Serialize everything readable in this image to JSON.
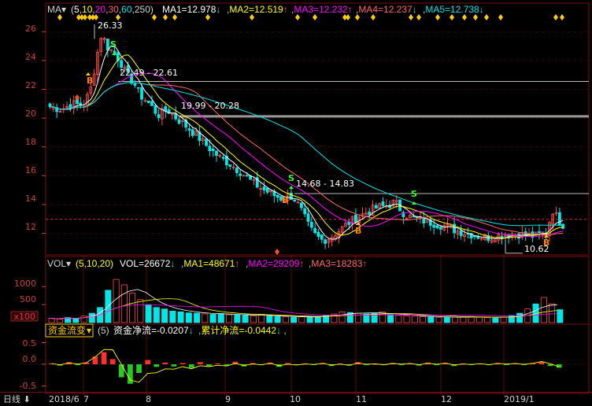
{
  "colors": {
    "up": "#ff4d4d",
    "down": "#00e5e5",
    "ma5": "#ffffff",
    "ma10": "#ffff00",
    "ma20": "#ff00ff",
    "ma30": "#ff6666",
    "ma60": "#00e5e5",
    "grid": "#7a1010",
    "axis_text": "#c84040",
    "label_yellow": "#ffcc00",
    "buy": "#ff7f00",
    "sell": "#33ff33"
  },
  "price_panel": {
    "title": "MA",
    "params": [
      "5",
      "10",
      "20",
      "30",
      "60",
      "250"
    ],
    "ma1": "MA1=12.978",
    "ma1_arrow": "↓",
    "ma2": "MA2=12.519",
    "ma2_arrow": "↑",
    "ma3": "MA3=12.232",
    "ma3_arrow": "↑",
    "ma4": "MA4=12.237",
    "ma4_arrow": "↓",
    "ma5": "MA5=12.738",
    "ma5_arrow": "↓",
    "y_ticks": [
      "26",
      "24",
      "22",
      "20",
      "18",
      "16",
      "14",
      "12"
    ],
    "annotations": [
      {
        "text": "26.33"
      },
      {
        "text": "22.49 - 22.61"
      },
      {
        "text": "19.99 - 20.28"
      },
      {
        "text": "14.68 - 14.83"
      },
      {
        "text": "10.62"
      }
    ],
    "signals": [
      "B",
      "S",
      "S",
      "B",
      "B",
      "S",
      "B"
    ]
  },
  "vol_panel": {
    "title": "VOL",
    "params": "(5,10,20)",
    "vol": "VOL=26672",
    "vol_arrow": "↓",
    "ma1": "MA1=48671",
    "ma1_arrow": "↑",
    "ma2": "MA2=29209",
    "ma2_arrow": "↑",
    "ma3": "MA3=18283",
    "ma3_arrow": "↑",
    "y_ticks": [
      "1000",
      "500"
    ],
    "unit": "x100"
  },
  "flow_panel": {
    "title": "资金流变",
    "params": "(5)",
    "net": "资金净流=-0.0207",
    "net_arrow": "↓",
    "cum": "累计净流=-0.0442",
    "cum_arrow": "↓",
    "y_ticks": [
      "0.5",
      "0.0",
      "-0.5"
    ]
  },
  "x_axis": {
    "period": "日线",
    "labels": [
      "2018/6",
      "7",
      "8",
      "9",
      "10",
      "11",
      "12",
      "2019/1"
    ]
  },
  "chart_data": {
    "type": "candlestick",
    "period": "日线",
    "x_labels": [
      "2018/6",
      "7",
      "8",
      "9",
      "10",
      "11",
      "12",
      "2019/1"
    ],
    "ylim": [
      10.5,
      27.0
    ],
    "y_ticks": [
      12,
      14,
      16,
      18,
      20,
      22,
      24,
      26
    ],
    "price_path": [
      [
        0,
        20.8
      ],
      [
        10,
        20.6
      ],
      [
        20,
        21.0
      ],
      [
        30,
        20.9
      ],
      [
        36,
        22.0
      ],
      [
        42,
        24.5
      ],
      [
        46,
        26.0
      ],
      [
        50,
        25.0
      ],
      [
        56,
        24.6
      ],
      [
        62,
        24.0
      ],
      [
        68,
        23.0
      ],
      [
        74,
        22.5
      ],
      [
        80,
        21.6
      ],
      [
        88,
        21.0
      ],
      [
        96,
        20.2
      ],
      [
        104,
        20.6
      ],
      [
        112,
        20.0
      ],
      [
        120,
        19.5
      ],
      [
        130,
        18.8
      ],
      [
        140,
        18.0
      ],
      [
        150,
        17.3
      ],
      [
        160,
        16.8
      ],
      [
        170,
        16.2
      ],
      [
        180,
        15.5
      ],
      [
        190,
        15.0
      ],
      [
        200,
        14.6
      ],
      [
        206,
        14.4
      ],
      [
        212,
        14.7
      ],
      [
        218,
        14.3
      ],
      [
        224,
        13.4
      ],
      [
        230,
        12.4
      ],
      [
        236,
        11.8
      ],
      [
        242,
        11.5
      ],
      [
        250,
        11.8
      ],
      [
        258,
        12.3
      ],
      [
        266,
        12.8
      ],
      [
        274,
        13.2
      ],
      [
        282,
        13.5
      ],
      [
        290,
        13.8
      ],
      [
        298,
        13.9
      ],
      [
        306,
        14.2
      ],
      [
        312,
        13.5
      ],
      [
        320,
        13.1
      ],
      [
        330,
        12.9
      ],
      [
        340,
        12.7
      ],
      [
        350,
        12.5
      ],
      [
        360,
        12.2
      ],
      [
        370,
        12.0
      ],
      [
        380,
        11.8
      ],
      [
        390,
        11.7
      ],
      [
        400,
        11.9
      ],
      [
        410,
        12.0
      ],
      [
        420,
        11.9
      ],
      [
        430,
        11.8
      ],
      [
        440,
        12.1
      ],
      [
        446,
        13.6
      ],
      [
        452,
        12.8
      ],
      [
        458,
        12.4
      ]
    ],
    "ma_lines": [
      {
        "name": "MA1",
        "values": [
          12.978
        ]
      },
      {
        "name": "MA2",
        "values": [
          12.519
        ]
      },
      {
        "name": "MA3",
        "values": [
          12.232
        ]
      },
      {
        "name": "MA4",
        "values": [
          12.237
        ]
      },
      {
        "name": "MA5",
        "values": [
          12.738
        ]
      }
    ],
    "annotations": [
      26.33,
      22.49,
      22.61,
      19.99,
      20.28,
      14.68,
      14.83,
      10.62
    ],
    "vol_ylim": [
      0,
      1400
    ],
    "volume": [
      120,
      100,
      140,
      110,
      180,
      260,
      420,
      900,
      1200,
      1050,
      820,
      640,
      500,
      420,
      380,
      320,
      300,
      270,
      260,
      240,
      230,
      250,
      220,
      210,
      200,
      190,
      230,
      180,
      170,
      160,
      150,
      170,
      160,
      150,
      200,
      240,
      300,
      280,
      260,
      240,
      260,
      300,
      220,
      200,
      190,
      180,
      170,
      160,
      150,
      140,
      150,
      160,
      170,
      150,
      140,
      130,
      150,
      200,
      260,
      380,
      520,
      700,
      520,
      360
    ],
    "vol_stats": {
      "VOL": 26672,
      "MA1": 48671,
      "MA2": 29209,
      "MA3": 18283
    },
    "flow_ylim": [
      -0.6,
      0.6
    ],
    "flow": [
      0.02,
      -0.03,
      0.05,
      -0.02,
      0.04,
      0.18,
      0.28,
      0.12,
      -0.3,
      -0.45,
      -0.2,
      0.1,
      -0.06,
      0.04,
      -0.05,
      0.03,
      -0.08,
      0.05,
      -0.04,
      0.02,
      -0.03,
      0.06,
      -0.05,
      0.03,
      -0.02,
      0.04,
      -0.06,
      0.03,
      -0.02,
      0.02,
      -0.01,
      0.03,
      -0.04,
      0.02,
      -0.03,
      0.05,
      -0.02,
      0.01,
      -0.02,
      0.03,
      -0.01,
      0.02,
      -0.03,
      0.04,
      -0.02,
      0.03,
      -0.04,
      0.02,
      -0.01,
      0.02,
      -0.02,
      0.03,
      -0.01,
      0.02,
      -0.02,
      0.03,
      0.06,
      -0.04,
      -0.08
    ],
    "flow_stats": {
      "资金净流": -0.0207,
      "累计净流": -0.0442
    }
  }
}
